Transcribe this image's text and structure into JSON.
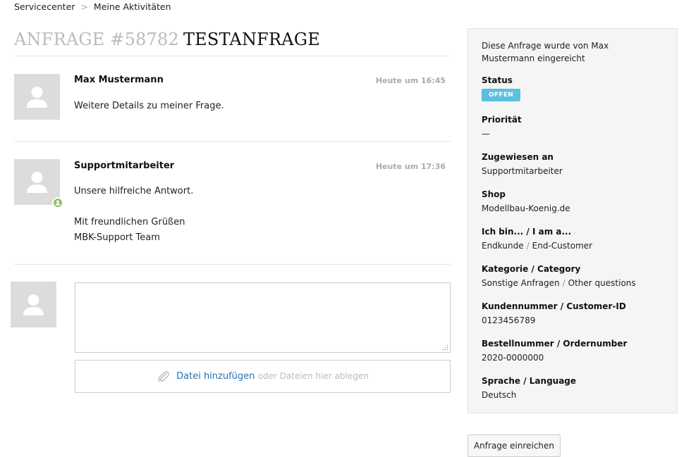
{
  "breadcrumb": {
    "items": [
      "Servicecenter",
      "Meine Aktivitäten"
    ],
    "separator": ">"
  },
  "title": {
    "number": "ANFRAGE #58782",
    "name": "TESTANFRAGE"
  },
  "messages": [
    {
      "author": "Max Mustermann",
      "time": "Heute um 16:45",
      "lines": [
        "Weitere Details zu meiner Frage."
      ]
    },
    {
      "author": "Supportmitarbeiter",
      "time": "Heute um 17:36",
      "lines": [
        "Unsere hilfreiche Antwort.",
        "",
        "Mit freundlichen Grüßen",
        "MBK-Support Team"
      ]
    }
  ],
  "reply": {
    "value": "",
    "attach_link": "Datei hinzufügen",
    "attach_hint": "oder Dateien hier ablegen"
  },
  "sidebar": {
    "intro": "Diese Anfrage wurde von Max Mustermann eingereicht",
    "status_label": "Status",
    "status_value": "OFFEN",
    "status_color": "#5bc0de",
    "fields": [
      {
        "label": "Priorität",
        "value": "—"
      },
      {
        "label": "Zugewiesen an",
        "value": "Supportmitarbeiter"
      },
      {
        "label": "Shop",
        "value": "Modellbau-Koenig.de"
      },
      {
        "label": "Ich bin... / I am a...",
        "value_a": "Endkunde",
        "value_b": "End-Customer"
      },
      {
        "label": "Kategorie / Category",
        "value_a": "Sonstige Anfragen",
        "value_b": "Other questions"
      },
      {
        "label": "Kundennummer / Customer-ID",
        "value": "0123456789"
      },
      {
        "label": "Bestellnummer / Ordernumber",
        "value": "2020-0000000"
      },
      {
        "label": "Sprache / Language",
        "value": "Deutsch"
      }
    ]
  },
  "submit_label": "Anfrage einreichen"
}
